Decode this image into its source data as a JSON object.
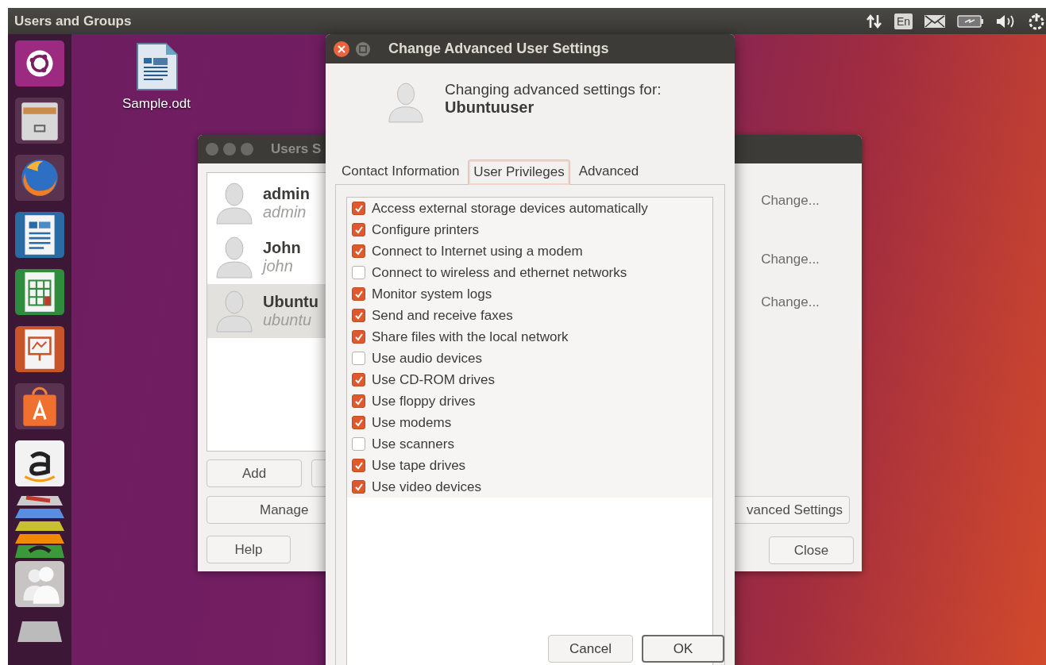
{
  "top_bar": {
    "title": "Users and Groups",
    "keyboard_indicator": "En"
  },
  "desktop_icons": [
    {
      "label": "Sample.odt"
    }
  ],
  "users_window": {
    "title": "Users S",
    "users": [
      {
        "name": "admin",
        "login": "admin",
        "selected": false
      },
      {
        "name": "John",
        "login": "john",
        "selected": false
      },
      {
        "name": "Ubuntu",
        "login": "ubuntu",
        "selected": true
      }
    ],
    "change_links": [
      "Change...",
      "Change...",
      "Change..."
    ],
    "add_button": "Add",
    "manage_button": "Manage",
    "help_button": "Help",
    "advanced_button": "vanced Settings",
    "close_button": "Close"
  },
  "dialog": {
    "title": "Change Advanced User Settings",
    "heading": "Changing advanced settings for:",
    "user": "Ubuntuuser",
    "tabs": [
      {
        "label": "Contact Information",
        "selected": false
      },
      {
        "label": "User Privileges",
        "selected": true
      },
      {
        "label": "Advanced",
        "selected": false
      }
    ],
    "privileges": [
      {
        "label": "Access external storage devices automatically",
        "checked": true
      },
      {
        "label": "Configure printers",
        "checked": true
      },
      {
        "label": "Connect to Internet using a modem",
        "checked": true
      },
      {
        "label": "Connect to wireless and ethernet networks",
        "checked": false
      },
      {
        "label": "Monitor system logs",
        "checked": true
      },
      {
        "label": "Send and receive faxes",
        "checked": true
      },
      {
        "label": "Share files with the local network",
        "checked": true
      },
      {
        "label": "Use audio devices",
        "checked": false
      },
      {
        "label": "Use CD-ROM drives",
        "checked": true
      },
      {
        "label": "Use floppy drives",
        "checked": true
      },
      {
        "label": "Use modems",
        "checked": true
      },
      {
        "label": "Use scanners",
        "checked": false
      },
      {
        "label": "Use tape drives",
        "checked": true
      },
      {
        "label": "Use video devices",
        "checked": true
      }
    ],
    "buttons": [
      {
        "label": "Cancel",
        "default": false
      },
      {
        "label": "OK",
        "default": true
      }
    ]
  }
}
